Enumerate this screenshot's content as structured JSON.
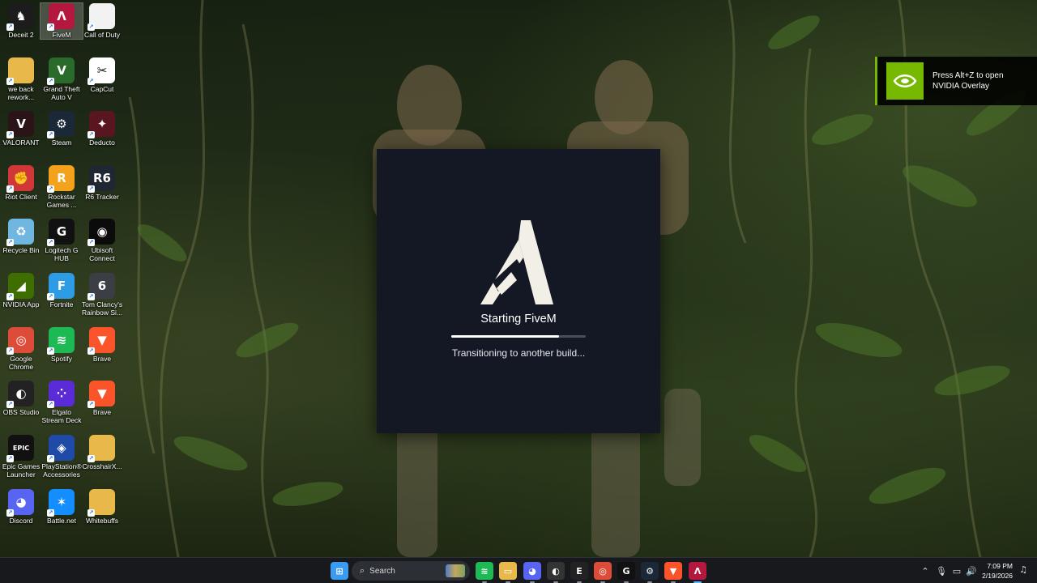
{
  "desktop": {
    "icons": [
      {
        "label": "Deceit 2",
        "glyph": "♞",
        "icon": "deceit-icon",
        "color": "#1c1c1c"
      },
      {
        "label": "FiveM",
        "glyph": "Λ",
        "icon": "fivem-icon",
        "color": "#b4183f"
      },
      {
        "label": "Call of Duty",
        "glyph": "",
        "icon": "blank-file-icon",
        "color": "#f2f2f2"
      },
      {
        "label": "we back rework...",
        "glyph": "",
        "icon": "folder-icon",
        "color": "#e8b84a"
      },
      {
        "label": "Grand Theft Auto V",
        "glyph": "V",
        "icon": "gta-icon",
        "color": "#2a6a2a"
      },
      {
        "label": "CapCut",
        "glyph": "✂",
        "icon": "capcut-icon",
        "color": "#ffffff"
      },
      {
        "label": "VALORANT",
        "glyph": "V",
        "icon": "valorant-icon",
        "color": "#2a1418"
      },
      {
        "label": "Steam",
        "glyph": "⚙",
        "icon": "steam-icon",
        "color": "#1b2838"
      },
      {
        "label": "Deducto",
        "glyph": "✦",
        "icon": "deducto-icon",
        "color": "#5a1620"
      },
      {
        "label": "Riot Client",
        "glyph": "✊",
        "icon": "riot-icon",
        "color": "#d13639"
      },
      {
        "label": "Rockstar Games ...",
        "glyph": "R",
        "icon": "rockstar-icon",
        "color": "#f4a11b"
      },
      {
        "label": "R6 Tracker",
        "glyph": "R6",
        "icon": "r6-tracker-icon",
        "color": "#1f2733"
      },
      {
        "label": "Recycle Bin",
        "glyph": "♻",
        "icon": "recycle-bin-icon",
        "color": "#6fb7e0"
      },
      {
        "label": "Logitech G HUB",
        "glyph": "G",
        "icon": "logitech-icon",
        "color": "#111111"
      },
      {
        "label": "Ubisoft Connect",
        "glyph": "◉",
        "icon": "ubisoft-icon",
        "color": "#0b0b0b"
      },
      {
        "label": "NVIDIA App",
        "glyph": "◢",
        "icon": "nvidia-icon",
        "color": "#3f6e00"
      },
      {
        "label": "Fortnite",
        "glyph": "F",
        "icon": "fortnite-icon",
        "color": "#2e9be5"
      },
      {
        "label": "Tom Clancy's Rainbow Si...",
        "glyph": "6",
        "icon": "rainbow-six-icon",
        "color": "#3b3f45"
      },
      {
        "label": "Google Chrome",
        "glyph": "◎",
        "icon": "chrome-icon",
        "color": "#dd4b39"
      },
      {
        "label": "Spotify",
        "glyph": "≋",
        "icon": "spotify-icon",
        "color": "#1db954"
      },
      {
        "label": "Brave",
        "glyph": "▼",
        "icon": "brave-icon",
        "color": "#fb542b"
      },
      {
        "label": "OBS Studio",
        "glyph": "◐",
        "icon": "obs-icon",
        "color": "#222222"
      },
      {
        "label": "Elgato Stream Deck",
        "glyph": "⁘",
        "icon": "stream-deck-icon",
        "color": "#5a2bd6"
      },
      {
        "label": "Brave",
        "glyph": "▼",
        "icon": "brave-icon",
        "color": "#fb542b"
      },
      {
        "label": "Epic Games Launcher",
        "glyph": "EPIC",
        "icon": "epic-games-icon",
        "color": "#111111"
      },
      {
        "label": "PlayStation® Accessories",
        "glyph": "◈",
        "icon": "playstation-icon",
        "color": "#1f4aa8"
      },
      {
        "label": "CrosshairX...",
        "glyph": "",
        "icon": "folder-icon",
        "color": "#e8b84a"
      },
      {
        "label": "Discord",
        "glyph": "◕",
        "icon": "discord-icon",
        "color": "#5865f2"
      },
      {
        "label": "Battle.net",
        "glyph": "✶",
        "icon": "battlenet-icon",
        "color": "#148eff"
      },
      {
        "label": "Whitebuffs",
        "glyph": "",
        "icon": "folder-icon",
        "color": "#e8b84a"
      }
    ]
  },
  "nvidia_toast": {
    "line1": "Press Alt+Z to open",
    "line2": "NVIDIA Overlay",
    "accent": "#76b900"
  },
  "splash": {
    "title": "Starting FiveM",
    "status": "Transitioning to another build...",
    "progress": 0.8,
    "background": "#141824"
  },
  "taskbar": {
    "search_placeholder": "Search",
    "apps": [
      {
        "icon": "windows-start-icon",
        "glyph": "⊞",
        "color": "#3a9bf0"
      },
      {
        "icon": "spotify-icon",
        "glyph": "≋",
        "color": "#1db954"
      },
      {
        "icon": "file-explorer-icon",
        "glyph": "▭",
        "color": "#e8b84a"
      },
      {
        "icon": "discord-icon",
        "glyph": "◕",
        "color": "#5865f2"
      },
      {
        "icon": "obs-icon",
        "glyph": "◐",
        "color": "#333333"
      },
      {
        "icon": "epic-games-icon",
        "glyph": "E",
        "color": "#222222"
      },
      {
        "icon": "chrome-icon",
        "glyph": "◎",
        "color": "#dd4b39"
      },
      {
        "icon": "logitech-icon",
        "glyph": "G",
        "color": "#111111"
      },
      {
        "icon": "steam-icon",
        "glyph": "⚙",
        "color": "#1b2838"
      },
      {
        "icon": "brave-icon",
        "glyph": "▼",
        "color": "#fb542b"
      },
      {
        "icon": "fivem-icon",
        "glyph": "Λ",
        "color": "#b4183f"
      }
    ],
    "time": "7:09 PM",
    "date": "2/19/2026"
  }
}
